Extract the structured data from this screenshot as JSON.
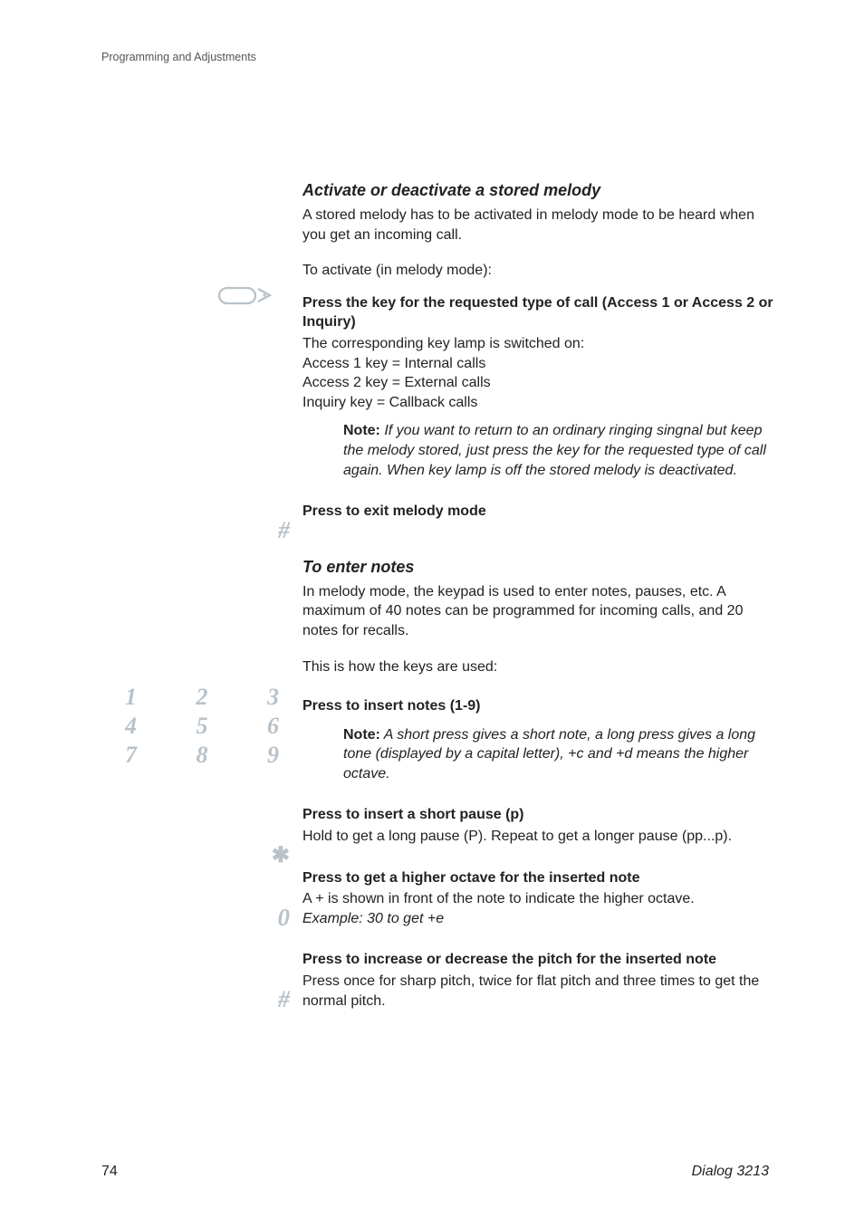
{
  "header": {
    "text": "Programming and Adjustments"
  },
  "footer": {
    "pageNumber": "74",
    "model": "Dialog 3213"
  },
  "section1": {
    "title": "Activate or deactivate a stored melody",
    "intro": "A stored melody has to be activated in melody mode to be heard when you get an incoming call.",
    "lead": "To activate (in melody mode):",
    "step1_heading": "Press the key for the requested type of call (Access 1 or Access 2 or Inquiry)",
    "step1_line1": "The corresponding key lamp is switched on:",
    "step1_line2": "Access 1 key = Internal calls",
    "step1_line3": "Access 2 key = External calls",
    "step1_line4": "Inquiry key = Callback calls",
    "note1_label": "Note:",
    "note1_body": " If you want to return to an ordinary ringing singnal but keep the melody stored, just press the key for the requested type of call again. When key lamp is off the stored melody is deactivated.",
    "hash1_heading": "Press to exit melody mode"
  },
  "section2": {
    "title": "To enter notes",
    "intro": "In melody mode, the keypad is used to enter notes, pauses, etc. A maximum of 40 notes can be programmed for incoming calls, and 20 notes for recalls.",
    "lead": "This is how the keys are used:",
    "keypad": [
      [
        "1",
        "2",
        "3"
      ],
      [
        "4",
        "5",
        "6"
      ],
      [
        "7",
        "8",
        "9"
      ]
    ],
    "insert_heading": "Press to insert notes (1-9)",
    "insert_note_label": "Note:",
    "insert_note_body": " A short press gives a short note, a long press gives a long tone (displayed by a capital letter), +c and +d means the higher octave.",
    "pause_heading": "Press to insert a short pause (p)",
    "pause_body": "Hold to get a long pause (P). Repeat to get a longer pause (pp...p).",
    "octave_heading": "Press to get a higher octave for the inserted note",
    "octave_body": "A + is shown in front of the note to indicate the higher octave.",
    "octave_example": "Example: 30 to get +e",
    "pitch_heading": "Press to increase or decrease the pitch for the inserted note",
    "pitch_body": "Press once for sharp pitch, twice for flat pitch and three times to get the normal pitch."
  },
  "gutter": {
    "hash": "#",
    "star": "✱",
    "zero": "0"
  }
}
